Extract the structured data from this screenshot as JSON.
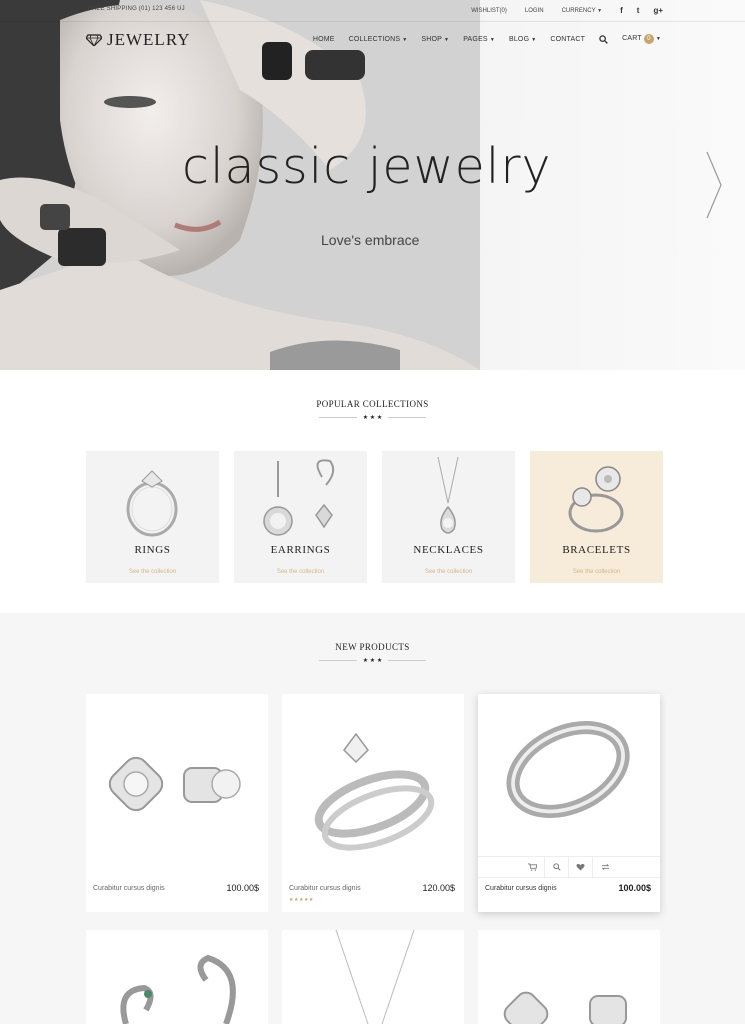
{
  "topbar": {
    "phone": "FREE SHIPPING (01) 123 456 UJ",
    "wishlist": "WISHLIST(0)",
    "login": "LOGIN",
    "currency": "CURRENCY",
    "social": [
      "f",
      "t",
      "g+"
    ]
  },
  "header": {
    "logo": "JEWELRY",
    "nav": [
      "HOME",
      "COLLECTIONS",
      "SHOP",
      "PAGES",
      "BLOG",
      "CONTACT"
    ],
    "cart_label": "CART",
    "cart_count": "0"
  },
  "hero": {
    "title": "classic jewelry",
    "subtitle": "Love's embrace"
  },
  "popular": {
    "title": "POPULAR COLLECTIONS",
    "items": [
      {
        "name": "RINGS",
        "link": "See the collection"
      },
      {
        "name": "EARRINGS",
        "link": "See the collection"
      },
      {
        "name": "NECKLACES",
        "link": "See the collection"
      },
      {
        "name": "BRACELETS",
        "link": "See the collection"
      }
    ]
  },
  "new_products": {
    "title": "NEW PRODUCTS",
    "items": [
      {
        "name": "Curabitur cursus dignis",
        "price": "100.00$"
      },
      {
        "name": "Curabitur cursus dignis",
        "price": "120.00$",
        "rating": "★★★★★"
      },
      {
        "name": "Curabitur cursus dignis",
        "price": "100.00$"
      }
    ]
  },
  "colors": {
    "accent": "#c9a46a",
    "beige": "#f6ecd9"
  },
  "icons": [
    "diamond-logo-icon",
    "search-icon",
    "cart-icon",
    "heart-icon",
    "compare-icon",
    "chevron-right-icon"
  ]
}
